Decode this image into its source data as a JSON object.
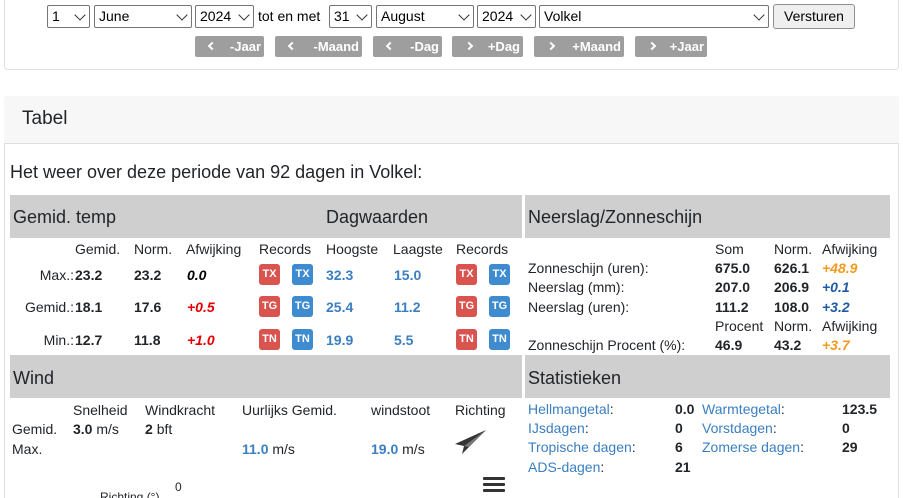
{
  "form": {
    "start_day": "1",
    "start_month": "June",
    "start_year": "2024",
    "separator": "tot en met",
    "end_day": "31",
    "end_month": "August",
    "end_year": "2024",
    "station": "Volkel",
    "submit_label": "Versturen"
  },
  "nav_buttons": [
    "-Jaar",
    "-Maand",
    "-Dag",
    "+Dag",
    "+Maand",
    "+Jaar"
  ],
  "section_title": "Tabel",
  "intro": "Het weer over deze periode van 92 dagen in Volkel:",
  "temp": {
    "band_title": "Gemid. temp",
    "band_title_2": "Dagwaarden",
    "headers": [
      "Gemid.",
      "Norm.",
      "Afwijking",
      "Records",
      "Hoogste",
      "Laagste",
      "Records"
    ],
    "rows": [
      {
        "label": "Max.:",
        "avg": "23.2",
        "norm": "23.2",
        "dev": "0.0",
        "badge": "TX",
        "high": "32.3",
        "low": "15.0"
      },
      {
        "label": "Gemid.:",
        "avg": "18.1",
        "norm": "17.6",
        "dev": "+0.5",
        "badge": "TG",
        "high": "25.4",
        "low": "11.2"
      },
      {
        "label": "Min.:",
        "avg": "12.7",
        "norm": "11.8",
        "dev": "+1.0",
        "badge": "TN",
        "high": "19.9",
        "low": "5.5"
      }
    ]
  },
  "precip": {
    "band_title": "Neerslag/Zonneschijn",
    "headers": [
      "Som",
      "Norm.",
      "Afwijking"
    ],
    "rows": [
      {
        "label": "Zonneschijn (uren):",
        "sum": "675.0",
        "norm": "626.1",
        "dev": "+48.9"
      },
      {
        "label": "Neerslag (mm):",
        "sum": "207.0",
        "norm": "206.9",
        "dev": "+0.1"
      },
      {
        "label": "Neerslag (uren):",
        "sum": "111.2",
        "norm": "108.0",
        "dev": "+3.2"
      }
    ],
    "headers2": [
      "Procent",
      "Norm.",
      "Afwijking"
    ],
    "pct_row": {
      "label": "Zonneschijn Procent (%):",
      "pct": "46.9",
      "norm": "43.2",
      "dev": "+3.7"
    }
  },
  "wind": {
    "band_title": "Wind",
    "headers": [
      "Snelheid",
      "Windkracht",
      "Uurlijks Gemid.",
      "windstoot",
      "Richting"
    ],
    "avg_label": "Gemid.",
    "avg_speed": "3.0",
    "avg_speed_unit": "m/s",
    "avg_force": "2",
    "avg_force_unit": "bft",
    "max_label": "Max.",
    "max_hourly": "11.0",
    "max_hourly_unit": "m/s",
    "max_gust": "19.0",
    "max_gust_unit": "m/s",
    "chart_zero": "0",
    "chart_label": "Richting (°)"
  },
  "stats": {
    "band_title": "Statistieken",
    "left": [
      {
        "label": "Hellmangetal",
        "suffix": ":",
        "value": "0.0"
      },
      {
        "label": "IJsdagen",
        "suffix": ":",
        "value": "0"
      },
      {
        "label": "Tropische dagen",
        "suffix": ":",
        "value": "6"
      },
      {
        "label": "ADS-dagen",
        "suffix": ":",
        "value": "21"
      }
    ],
    "right": [
      {
        "label": "Warmtegetal",
        "suffix": ":",
        "value": "123.5"
      },
      {
        "label": "Vorstdagen",
        "suffix": ":",
        "value": "0"
      },
      {
        "label": "Zomerse dagen",
        "suffix": ":",
        "value": "29"
      }
    ]
  },
  "icons": {
    "wind_direction": "paper-plane-arrow-icon",
    "menu": "hamburger-menu-icon",
    "dropdown": "chevron-down-icon",
    "nav_left": "chevron-left-icon",
    "nav_right": "chevron-right-icon"
  },
  "colors": {
    "band": "#cfcfcf",
    "link": "#3a7fc2",
    "badge_red": "#d9534f",
    "badge_blue": "#3f8bd0",
    "positive_dev": "#e40000",
    "sun_dev": "#f39a1d",
    "rain_dev": "#1f5aa6"
  }
}
